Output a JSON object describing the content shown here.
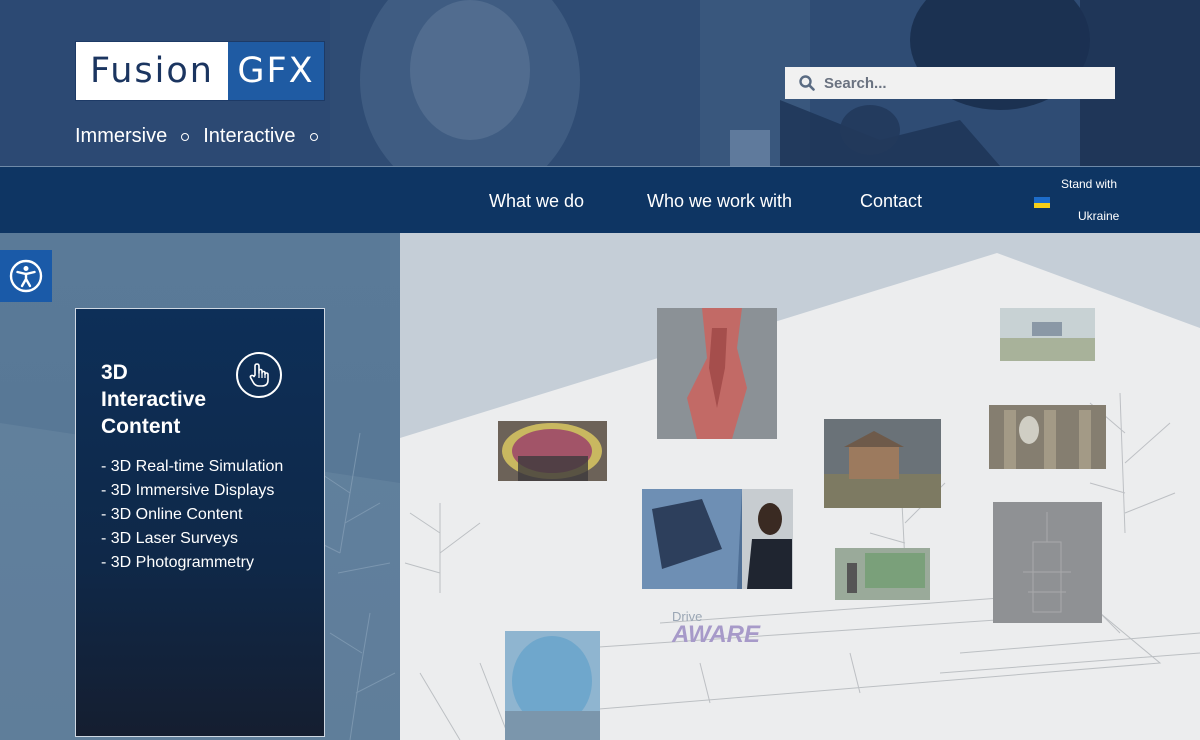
{
  "header": {
    "logo_left": "Fusion",
    "logo_right": "GFX",
    "tagline": [
      "Immersive",
      "Interactive"
    ],
    "search_placeholder": "Search..."
  },
  "nav": {
    "items": [
      "What we do",
      "Who we work with",
      "Contact"
    ],
    "ukraine_line1": "Stand with",
    "ukraine_line2": "Ukraine"
  },
  "card": {
    "title": "3D Interactive Content",
    "items": [
      "- 3D Real-time Simulation",
      "- 3D Immersive Displays",
      "- 3D Online Content",
      "- 3D Laser Surveys",
      "- 3D Photogrammetry"
    ]
  },
  "logos": {
    "drive_aware_top": "Drive",
    "drive_aware_bottom": "AWARE"
  },
  "colors": {
    "nav_bg": "#0e3563",
    "accent_blue": "#1f5ba3",
    "panel_blue": "#557593"
  },
  "icons": [
    "search-icon",
    "accessibility-icon",
    "hand-pointer-icon",
    "ukraine-flag-icon"
  ]
}
